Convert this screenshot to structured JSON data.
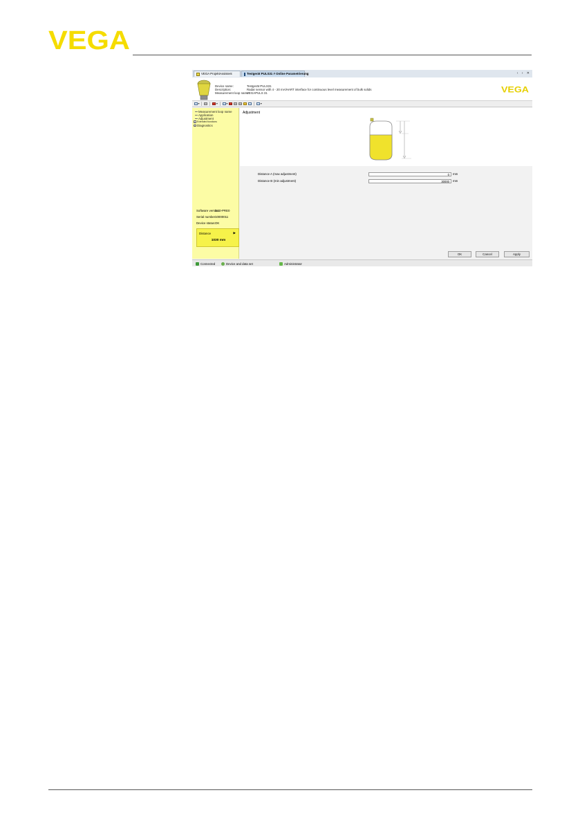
{
  "brand": {
    "logo_text": "VEGA",
    "color": "#f5dc00"
  },
  "tabs": [
    {
      "label": "VEGA ProjektAssistent",
      "active": false,
      "icon": "project-assistant-icon"
    },
    {
      "label": "Testgerät PULS31 # Online Parametrierung",
      "active": true,
      "icon": "device-dtm-icon"
    }
  ],
  "window_controls": "‹ › ✕",
  "device": {
    "rows": [
      {
        "label": "Device name:",
        "value": "Testgerät PULS31"
      },
      {
        "label": "Description:",
        "value": "Radar sensor with 4 - 20 mA/HART interface for continuous level measurement of bulk solids"
      },
      {
        "label": "Measurement loop name:",
        "value": "VEGAPULS 31"
      }
    ],
    "logo_text": "VEGA"
  },
  "tree": [
    {
      "label": "Measurement loop name",
      "level": 1,
      "expander": false
    },
    {
      "label": "Application",
      "level": 1,
      "expander": false
    },
    {
      "label": "Adjustment",
      "level": 1,
      "expander": false,
      "selected": true
    },
    {
      "label": "Extended functions",
      "level": 0,
      "expander": true
    },
    {
      "label": "Diagnostics",
      "level": 0,
      "expander": true
    }
  ],
  "properties": [
    {
      "label": "Software version:",
      "value": "0.10-PRE0"
    },
    {
      "label": "Serial number:",
      "value": "10000011"
    },
    {
      "label": "Device status:",
      "value": "OK"
    }
  ],
  "measured": {
    "label": "Distance",
    "value": "1030 mm"
  },
  "content": {
    "title": "Adjustment",
    "fields": [
      {
        "label": "Distance A (max adjustment)",
        "value": "0",
        "unit": "mm"
      },
      {
        "label": "Distance B (min adjustment)",
        "value": "30000",
        "unit": "mm"
      }
    ]
  },
  "buttons": {
    "ok": "OK",
    "cancel": "Cancel",
    "apply": "Apply"
  },
  "status": {
    "connection": "Connected",
    "sync": "Device and data set",
    "user": "Administrator"
  },
  "colors": {
    "sidebar_bg": "#fcfca5",
    "highlight_yellow": "#f6f24a",
    "vessel_fill": "#f0e22c"
  }
}
